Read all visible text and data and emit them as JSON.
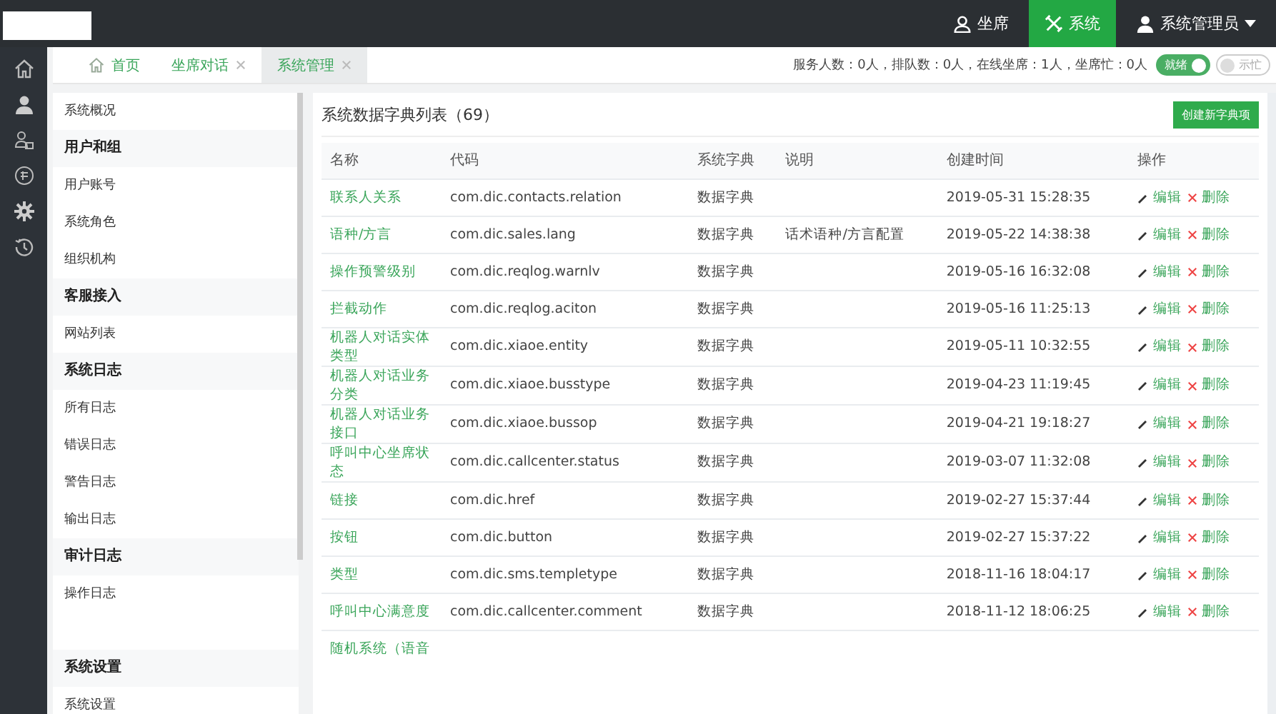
{
  "topnav": [
    {
      "label": "坐席",
      "selected": false
    },
    {
      "label": "系统",
      "selected": true
    },
    {
      "label": "系统管理员",
      "selected": false,
      "caret": true
    }
  ],
  "tabs": [
    {
      "label": "首页",
      "icon": true,
      "closable": false,
      "selected": false
    },
    {
      "label": "坐席对话",
      "closable": true,
      "selected": false
    },
    {
      "label": "系统管理",
      "closable": true,
      "selected": true
    }
  ],
  "status_text": "服务人数：0人，排队数：0人，在线坐席：1人，坐席忙：0人",
  "toggles": [
    {
      "label": "就绪",
      "on": true
    },
    {
      "label": "示忙",
      "on": false
    }
  ],
  "sidebar": [
    {
      "kind": "item",
      "label": "系统概况"
    },
    {
      "kind": "group",
      "label": "用户和组"
    },
    {
      "kind": "item",
      "label": "用户账号"
    },
    {
      "kind": "item",
      "label": "系统角色"
    },
    {
      "kind": "item",
      "label": "组织机构"
    },
    {
      "kind": "group",
      "label": "客服接入"
    },
    {
      "kind": "item",
      "label": "网站列表"
    },
    {
      "kind": "group",
      "label": "系统日志"
    },
    {
      "kind": "item",
      "label": "所有日志"
    },
    {
      "kind": "item",
      "label": "错误日志"
    },
    {
      "kind": "item",
      "label": "警告日志"
    },
    {
      "kind": "item",
      "label": "输出日志"
    },
    {
      "kind": "group",
      "label": "审计日志"
    },
    {
      "kind": "item",
      "label": "操作日志"
    },
    {
      "kind": "gap"
    },
    {
      "kind": "group",
      "label": "系统设置"
    },
    {
      "kind": "item",
      "label": "系统设置"
    }
  ],
  "panel": {
    "title": "系统数据字典列表（69）",
    "create_button": "创建新字典项"
  },
  "table": {
    "columns": [
      "名称",
      "代码",
      "系统字典",
      "说明",
      "创建时间",
      "操作"
    ],
    "rows": [
      {
        "name": "联系人关系",
        "code": "com.dic.contacts.relation",
        "type": "数据字典",
        "created": "2019-05-31 15:28:35",
        "edit": "编辑",
        "delete": "删除"
      },
      {
        "name": "语种/方言",
        "code": "com.dic.sales.lang",
        "type": "数据字典",
        "note": "话术语种/方言配置",
        "created": "2019-05-22 14:38:38",
        "edit": "编辑",
        "delete": "删除"
      },
      {
        "name": "操作预警级别",
        "code": "com.dic.reqlog.warnlv",
        "type": "数据字典",
        "created": "2019-05-16 16:32:08",
        "edit": "编辑",
        "delete": "删除"
      },
      {
        "name": "拦截动作",
        "code": "com.dic.reqlog.aciton",
        "type": "数据字典",
        "created": "2019-05-16 11:25:13",
        "edit": "编辑",
        "delete": "删除"
      },
      {
        "name": "机器人对话实体类型",
        "code": "com.dic.xiaoe.entity",
        "type": "数据字典",
        "created": "2019-05-11 10:32:55",
        "edit": "编辑",
        "delete": "删除"
      },
      {
        "name": "机器人对话业务分类",
        "code": "com.dic.xiaoe.busstype",
        "type": "数据字典",
        "created": "2019-04-23 11:19:45",
        "edit": "编辑",
        "delete": "删除"
      },
      {
        "name": "机器人对话业务接口",
        "code": "com.dic.xiaoe.bussop",
        "type": "数据字典",
        "created": "2019-04-21 19:18:27",
        "edit": "编辑",
        "delete": "删除"
      },
      {
        "name": "呼叫中心坐席状态",
        "code": "com.dic.callcenter.status",
        "type": "数据字典",
        "created": "2019-03-07 11:32:08",
        "edit": "编辑",
        "delete": "删除"
      },
      {
        "name": "链接",
        "code": "com.dic.href",
        "type": "数据字典",
        "created": "2019-02-27 15:37:44",
        "edit": "编辑",
        "delete": "删除"
      },
      {
        "name": "按钮",
        "code": "com.dic.button",
        "type": "数据字典",
        "created": "2019-02-27 15:37:22",
        "edit": "编辑",
        "delete": "删除"
      },
      {
        "name": "类型",
        "code": "com.dic.sms.templetype",
        "type": "数据字典",
        "created": "2018-11-16 18:04:17",
        "edit": "编辑",
        "delete": "删除"
      },
      {
        "name": "呼叫中心满意度",
        "code": "com.dic.callcenter.comment",
        "type": "数据字典",
        "created": "2018-11-12 18:06:25",
        "edit": "编辑",
        "delete": "删除"
      },
      {
        "name": "随机系统（语音"
      }
    ]
  }
}
